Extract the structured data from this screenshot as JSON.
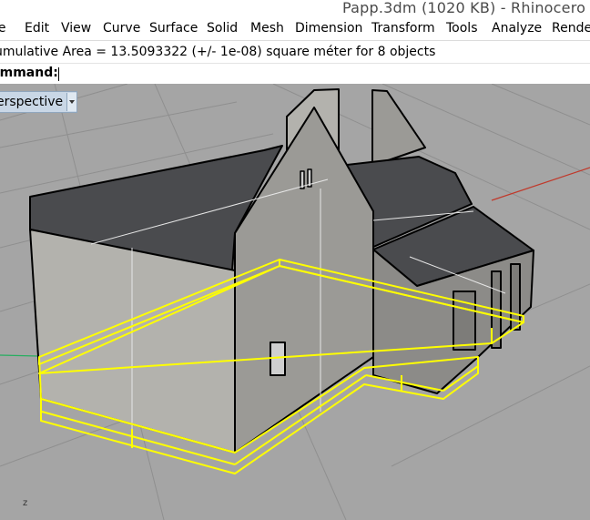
{
  "window": {
    "title": "Papp.3dm (1020 KB) - Rhinocero"
  },
  "menu": {
    "items": [
      "le",
      "Edit",
      "View",
      "Curve",
      "Surface",
      "Solid",
      "Mesh",
      "Dimension",
      "Transform",
      "Tools",
      "Analyze",
      "Rende"
    ]
  },
  "history": {
    "text": "umulative Area = 13.5093322 (+/- 1e-08) square méter for 8 objects"
  },
  "command": {
    "label": "ommand:",
    "value": ""
  },
  "viewport": {
    "name": "erspective",
    "axis_label": "z",
    "colors": {
      "background": "#a5a5a5",
      "grid": "#8f8f8f",
      "roof": "#4a4b4e",
      "wall_light": "#b3b2ad",
      "wall_dark": "#8c8b88",
      "selection": "#ffff00",
      "x_axis": "#c0392b",
      "y_axis": "#27ae60"
    }
  }
}
